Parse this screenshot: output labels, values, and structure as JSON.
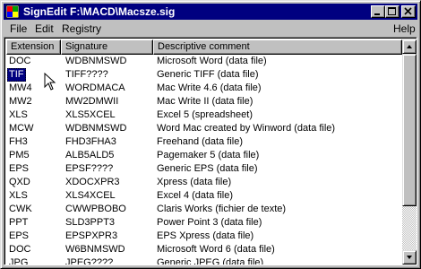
{
  "window": {
    "title": "SignEdit F:\\MACD\\Macsze.sig"
  },
  "menubar": {
    "file": "File",
    "edit": "Edit",
    "registry": "Registry",
    "help": "Help"
  },
  "list": {
    "headers": {
      "extension": "Extension",
      "signature": "Signature",
      "description": "Descriptive comment"
    },
    "selected_index": 1,
    "rows": [
      {
        "ext": "DOC",
        "sig": "WDBNMSWD",
        "desc": "Microsoft Word (data file)"
      },
      {
        "ext": "TIF",
        "sig": "TIFF????",
        "desc": "Generic TIFF (data file)"
      },
      {
        "ext": "MW4",
        "sig": "WORDMACA",
        "desc": "Mac Write 4.6 (data file)"
      },
      {
        "ext": "MW2",
        "sig": "MW2DMWII",
        "desc": "Mac Write II (data file)"
      },
      {
        "ext": "XLS",
        "sig": "XLS5XCEL",
        "desc": "Excel 5 (spreadsheet)"
      },
      {
        "ext": "MCW",
        "sig": "WDBNMSWD",
        "desc": "Word Mac created by Winword (data file)"
      },
      {
        "ext": "FH3",
        "sig": "FHD3FHA3",
        "desc": "Freehand (data file)"
      },
      {
        "ext": "PM5",
        "sig": "ALB5ALD5",
        "desc": "Pagemaker 5 (data file)"
      },
      {
        "ext": "EPS",
        "sig": "EPSF????",
        "desc": "Generic EPS (data file)"
      },
      {
        "ext": "QXD",
        "sig": "XDOCXPR3",
        "desc": "Xpress (data file)"
      },
      {
        "ext": "XLS",
        "sig": "XLS4XCEL",
        "desc": "Excel 4 (data file)"
      },
      {
        "ext": "CWK",
        "sig": "CWWPBOBO",
        "desc": "Claris Works (fichier de texte)"
      },
      {
        "ext": "PPT",
        "sig": "SLD3PPT3",
        "desc": "Power Point 3 (data file)"
      },
      {
        "ext": "EPS",
        "sig": "EPSPXPR3",
        "desc": "EPS Xpress (data file)"
      },
      {
        "ext": "DOC",
        "sig": "W6BNMSWD",
        "desc": "Microsoft Word 6 (data file)"
      },
      {
        "ext": "JPG",
        "sig": "JPEG????",
        "desc": "Generic JPEG (data file)"
      }
    ]
  },
  "colors": {
    "titlebar": "#000080",
    "face": "#c0c0c0",
    "selection": "#000080"
  },
  "icons": {
    "app": "signedit-app-icon",
    "minimize": "minimize-icon",
    "maximize": "maximize-icon",
    "close": "close-icon",
    "scroll_up": "arrow-up-icon",
    "scroll_down": "arrow-down-icon",
    "cursor": "mouse-pointer-icon"
  }
}
